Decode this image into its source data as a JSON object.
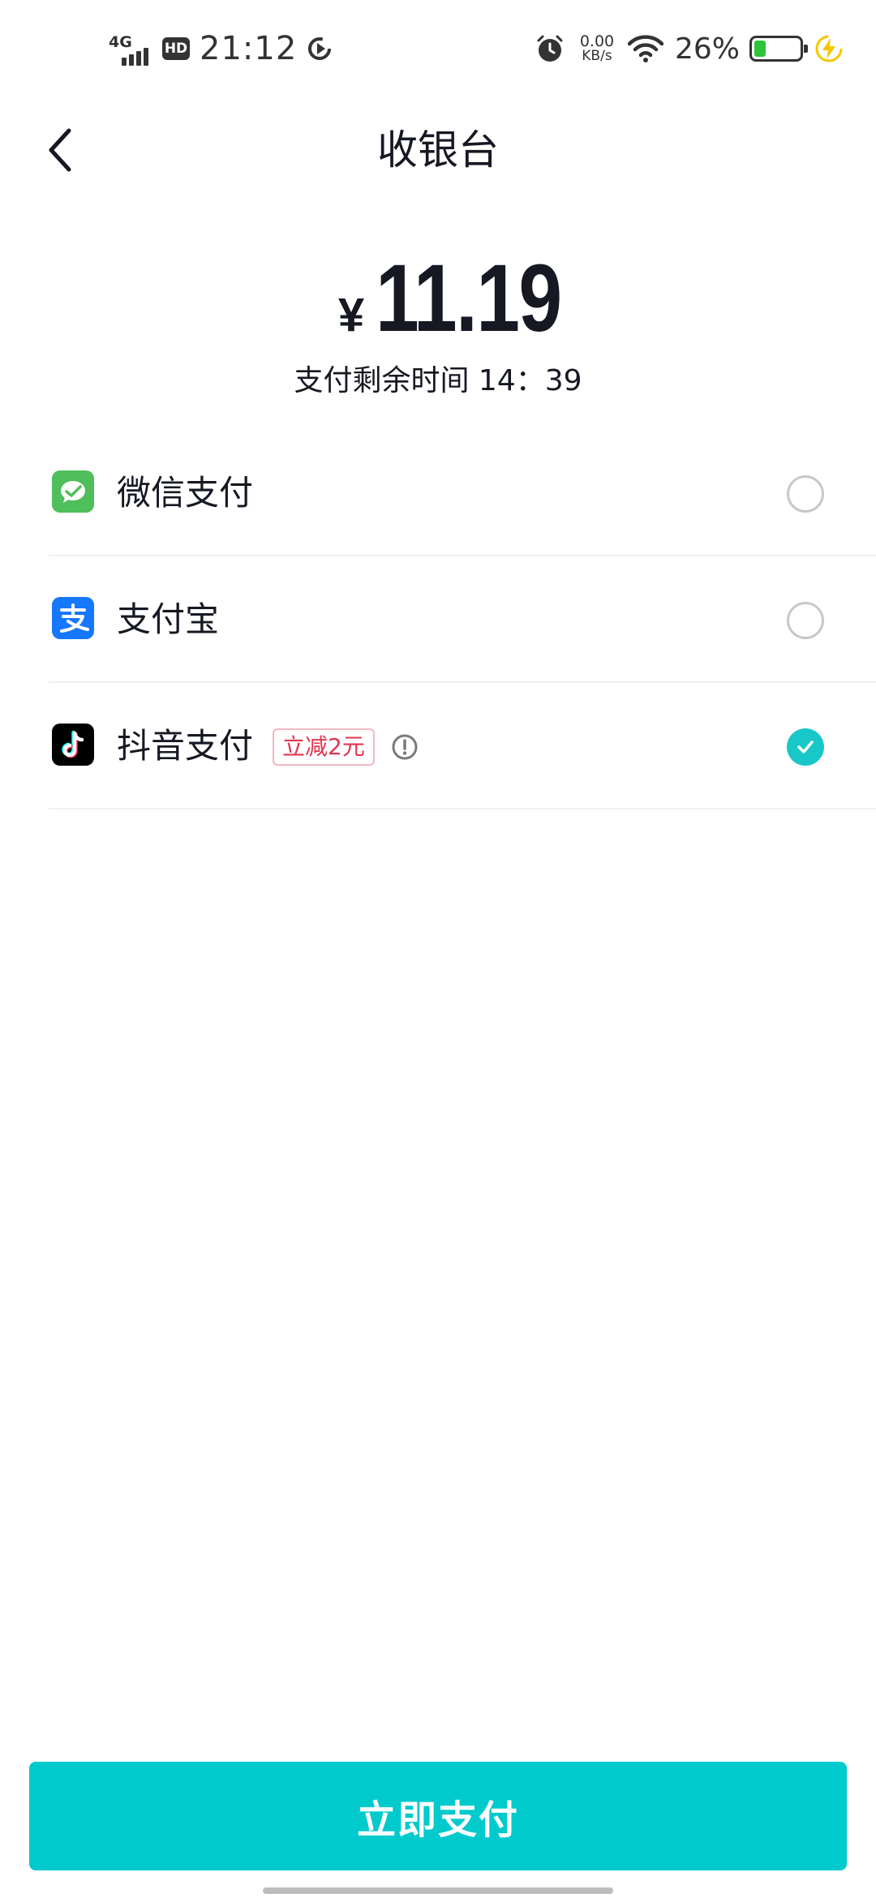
{
  "status_bar": {
    "network": "4G",
    "hd": "HD",
    "time": "21:12",
    "speed_value": "0.00",
    "speed_unit": "KB/s",
    "battery": "26%",
    "battery_level_pct": 26
  },
  "header": {
    "title": "收银台"
  },
  "amount": {
    "currency": "¥",
    "value": "11.19"
  },
  "countdown": "支付剩余时间 14：39",
  "payment_methods": [
    {
      "name": "微信支付",
      "icon": "wechat-pay-icon",
      "selected": false,
      "color": "#4fbf5b"
    },
    {
      "name": "支付宝",
      "icon": "alipay-icon",
      "selected": false,
      "color": "#1677ff"
    },
    {
      "name": "抖音支付",
      "icon": "douyin-icon",
      "selected": true,
      "badge": "立减2元",
      "color": "#000000"
    }
  ],
  "accent_color": "#00cacc",
  "pay_button_label": "立即支付"
}
